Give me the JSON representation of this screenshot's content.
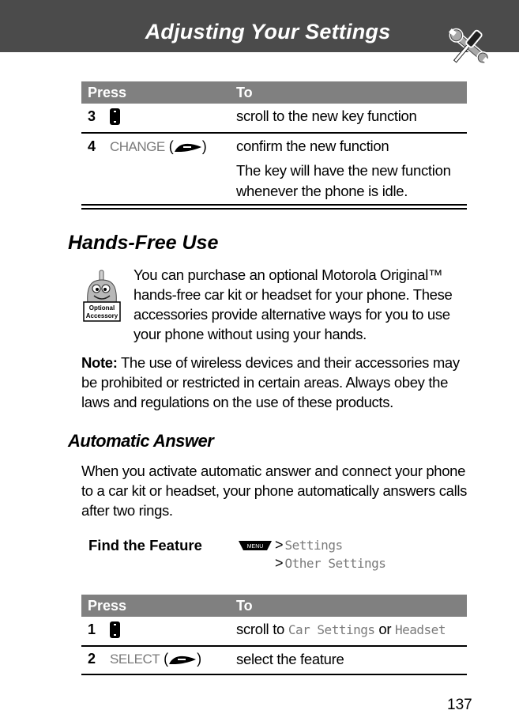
{
  "header": {
    "title": "Adjusting Your Settings",
    "icon": "wrench-screwdriver-icon"
  },
  "table1": {
    "headers": {
      "press": "Press",
      "to": "To"
    },
    "rows": [
      {
        "step": "3",
        "key_icon": "nav-key-icon",
        "key_label": "",
        "description": [
          "scroll to the new key function"
        ]
      },
      {
        "step": "4",
        "key_icon": "select-key-icon",
        "key_label": "CHANGE",
        "description": [
          "confirm the new function",
          "The key will have the new function whenever the phone is idle."
        ]
      }
    ]
  },
  "hands_free": {
    "heading": "Hands-Free Use",
    "icon_label_line1": "Optional",
    "icon_label_line2": "Accessory",
    "intro": "You can purchase an optional Motorola Original™ hands-free car kit or headset for your phone. These accessories provide alternative ways for you to use your phone without using your hands.",
    "note_label": "Note:",
    "note_text": " The use of wireless devices and their accessories may be prohibited or restricted in certain areas. Always obey the laws and regulations on the use of these products."
  },
  "automatic_answer": {
    "heading": "Automatic Answer",
    "body": "When you activate automatic answer and connect your phone to a car kit or headset, your phone automatically answers calls after two rings.",
    "find_feature_label": "Find the Feature",
    "menu_key_label": "MENU",
    "path": [
      ">",
      "Settings",
      ">",
      "Other Settings"
    ]
  },
  "table2": {
    "headers": {
      "press": "Press",
      "to": "To"
    },
    "rows": [
      {
        "step": "1",
        "key_icon": "nav-key-icon",
        "key_label": "",
        "description_prefix": "scroll to ",
        "option1": "Car Settings",
        "conjunction": " or ",
        "option2": "Headset"
      },
      {
        "step": "2",
        "key_icon": "select-key-icon",
        "key_label": "SELECT",
        "description": "select the feature"
      }
    ]
  },
  "page_number": "137"
}
